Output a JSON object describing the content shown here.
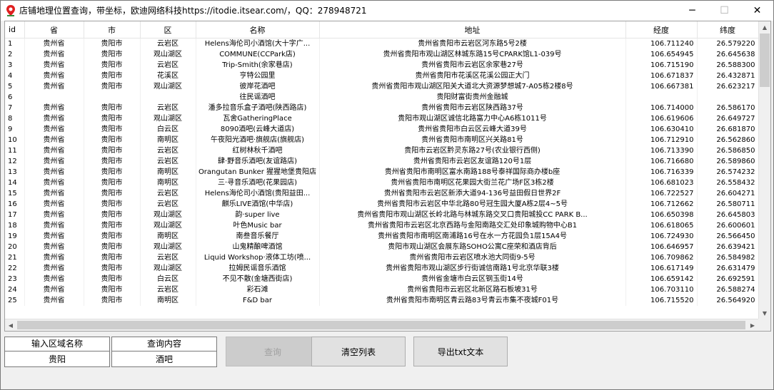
{
  "window": {
    "title": "店铺地理位置查询，带坐标，欧迪网络科技https://itodie.itsear.com/，QQ：278948721",
    "minimize_symbol": "─",
    "maximize_symbol": "☐",
    "close_symbol": "✕"
  },
  "grid": {
    "columns": [
      "id",
      "省",
      "市",
      "区",
      "名称",
      "地址",
      "经度",
      "纬度"
    ],
    "rows": [
      [
        "1",
        "贵州省",
        "贵阳市",
        "云岩区",
        "Helens海伦司小酒馆(大十字广...",
        "贵州省贵阳市云岩区河东路5号2楼",
        "106.711240",
        "26.579220"
      ],
      [
        "2",
        "贵州省",
        "贵阳市",
        "观山湖区",
        "COMMUNE(CCPark店)",
        "贵州省贵阳市观山湖区林城东路15号CPARK馆L1-039号",
        "106.654945",
        "26.645638"
      ],
      [
        "3",
        "贵州省",
        "贵阳市",
        "云岩区",
        "Trip-Smith(余家巷店)",
        "贵州省贵阳市云岩区余家巷27号",
        "106.715190",
        "26.588300"
      ],
      [
        "4",
        "贵州省",
        "贵阳市",
        "花溪区",
        "亨特公园里",
        "贵州省贵阳市花溪区花溪公园正大门",
        "106.671837",
        "26.432871"
      ],
      [
        "5",
        "贵州省",
        "贵阳市",
        "观山湖区",
        "彼岸花酒吧",
        "贵州省贵阳市观山湖区阳关大道北大资源梦想城7-A05栋2楼8号",
        "106.667381",
        "26.623217"
      ],
      [
        "6",
        "",
        "",
        "",
        "往民谣酒吧",
        "贵阳财富街贵州金融城",
        "",
        ""
      ],
      [
        "7",
        "贵州省",
        "贵阳市",
        "云岩区",
        "潘多拉音乐盒子酒吧(陕西路店)",
        "贵州省贵阳市云岩区陕西路37号",
        "106.714000",
        "26.586170"
      ],
      [
        "8",
        "贵州省",
        "贵阳市",
        "观山湖区",
        "瓦舍GatheringPlace",
        "贵阳市观山湖区诚信北路富力中心A6栋1011号",
        "106.619606",
        "26.649727"
      ],
      [
        "9",
        "贵州省",
        "贵阳市",
        "白云区",
        "8090酒吧(云峰大道店)",
        "贵州省贵阳市白云区云峰大道39号",
        "106.630410",
        "26.681870"
      ],
      [
        "10",
        "贵州省",
        "贵阳市",
        "南明区",
        "午夜阳光酒吧·旗舰店(旗舰店)",
        "贵州省贵阳市南明区兴关路81号",
        "106.712910",
        "26.562860"
      ],
      [
        "11",
        "贵州省",
        "贵阳市",
        "云岩区",
        "红树林秋千酒吧",
        "贵阳市云岩区黔灵东路27号(农业银行西侧)",
        "106.713390",
        "26.586850"
      ],
      [
        "12",
        "贵州省",
        "贵阳市",
        "云岩区",
        "肆·野音乐酒吧(友谊路店)",
        "贵州省贵阳市云岩区友谊路120号1层",
        "106.716680",
        "26.589860"
      ],
      [
        "13",
        "贵州省",
        "贵阳市",
        "南明区",
        "Orangutan Bunker 猩猩地堡贵阳店",
        "贵州省贵阳市南明区富水南路188号泰祥国际商办楼b座",
        "106.716339",
        "26.574232"
      ],
      [
        "14",
        "贵州省",
        "贵阳市",
        "南明区",
        "三·寻音乐酒吧(花果园店)",
        "贵州省贵阳市南明区花果园大街兰花广场F区3栋2楼",
        "106.681023",
        "26.558432"
      ],
      [
        "15",
        "贵州省",
        "贵阳市",
        "云岩区",
        "Helens海伦司小酒馆(贵阳益田...",
        "贵州省贵阳市云岩区新添大道94-136号益田假日世界2F",
        "106.722527",
        "26.604271"
      ],
      [
        "16",
        "贵州省",
        "贵阳市",
        "云岩区",
        "麒乐LIVE酒馆(中华店)",
        "贵州省贵阳市云岩区中华北路80号冠生园大厦A栋2层4~5号",
        "106.712662",
        "26.580711"
      ],
      [
        "17",
        "贵州省",
        "贵阳市",
        "观山湖区",
        "韵·super live",
        "贵州省贵阳市观山湖区长岭北路与林城东路交叉口贵阳城投CC PARK B...",
        "106.650398",
        "26.645803"
      ],
      [
        "18",
        "贵州省",
        "贵阳市",
        "观山湖区",
        "叶色Music bar",
        "贵州省贵阳市云岩区北京西路与金阳南路交汇处印象城购物中心B1",
        "106.618065",
        "26.600601"
      ],
      [
        "19",
        "贵州省",
        "贵阳市",
        "南明区",
        "南叁音乐餐厅",
        "贵州省贵阳市南明区南浦路16号在水一方花园负1层15A4号",
        "106.724930",
        "26.566450"
      ],
      [
        "20",
        "贵州省",
        "贵阳市",
        "观山湖区",
        "山鬼精酿啤酒馆",
        "贵阳市观山湖区会展东路SOHO公寓C座荣和酒店背后",
        "106.646957",
        "26.639421"
      ],
      [
        "21",
        "贵州省",
        "贵阳市",
        "云岩区",
        "Liquid Workshop·液体工坊(喷...",
        "贵州省贵阳市云岩区喷水池大同街9-5号",
        "106.709862",
        "26.584982"
      ],
      [
        "22",
        "贵州省",
        "贵阳市",
        "观山湖区",
        "拉姆民谣音乐酒馆",
        "贵州省贵阳市观山湖区步行街诚信南路1号北京华联3楼",
        "106.617149",
        "26.631479"
      ],
      [
        "23",
        "贵州省",
        "贵阳市",
        "白云区",
        "不见不散(金塘西街店)",
        "贵州省金塘市白云区钢玉街14号",
        "106.659142",
        "26.692591"
      ],
      [
        "24",
        "贵州省",
        "贵阳市",
        "云岩区",
        "彩石滩",
        "贵州省贵阳市云岩区北新区路石板坡31号",
        "106.703110",
        "26.588274"
      ],
      [
        "25",
        "贵州省",
        "贵阳市",
        "南明区",
        "F&D bar",
        "贵州省贵阳市南明区青云路83号青云市集不夜城F01号",
        "106.715520",
        "26.564920"
      ]
    ]
  },
  "controls": {
    "region_label": "输入区域名称",
    "region_value": "贵阳",
    "query_label": "查询内容",
    "query_value": "酒吧",
    "search_button": "查询",
    "clear_button": "清空列表",
    "export_button": "导出txt文本"
  }
}
